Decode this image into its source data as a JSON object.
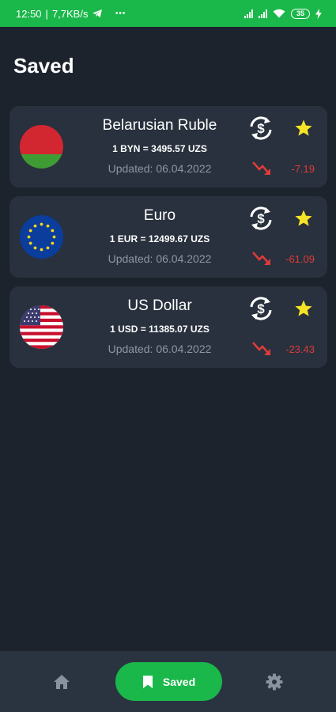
{
  "status_bar": {
    "time": "12:50",
    "network_speed": "7,7KB/s",
    "separator": "|",
    "overflow": "⋯",
    "battery": "35",
    "icons": [
      "telegram-icon",
      "signal-icon",
      "wifi-icon",
      "battery-icon",
      "charging-icon"
    ]
  },
  "page": {
    "title": "Saved"
  },
  "cards": [
    {
      "name": "Belarusian Ruble",
      "rate": "1 BYN = 3495.57 UZS",
      "updated": "Updated: 06.04.2022",
      "change": "-7.19",
      "trend": "down",
      "flag": "belarus-flag"
    },
    {
      "name": "Euro",
      "rate": "1 EUR = 12499.67 UZS",
      "updated": "Updated: 06.04.2022",
      "change": "-61.09",
      "trend": "down",
      "flag": "eu-flag"
    },
    {
      "name": "US Dollar",
      "rate": "1 USD = 11385.07 UZS",
      "updated": "Updated: 06.04.2022",
      "change": "-23.43",
      "trend": "down",
      "flag": "us-flag"
    }
  ],
  "bottom_nav": {
    "home_icon": "home-icon",
    "saved_label": "Saved",
    "saved_icon": "bookmark-icon",
    "settings_icon": "gear-icon",
    "active": "saved"
  },
  "colors": {
    "accent": "#1ab84a",
    "background": "#1c232d",
    "card": "#28313d",
    "negative": "#e03a3a",
    "star": "#f5e325"
  }
}
